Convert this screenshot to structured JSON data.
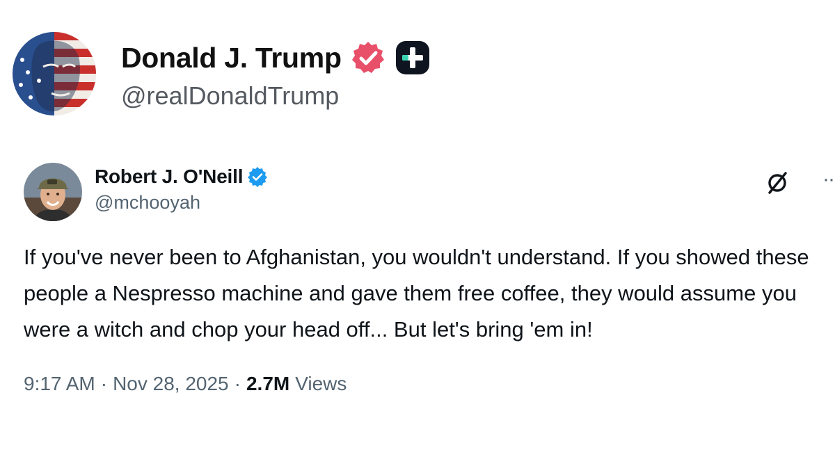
{
  "outer_post": {
    "display_name": "Donald J. Trump",
    "handle": "@realDonaldTrump",
    "avatar_icon": "flag-portrait-avatar",
    "badge_icon": "verified-badge-icon",
    "badge_color": "#e8506a",
    "plus_icon": "plus-badge-icon"
  },
  "embedded_post": {
    "display_name": "Robert J. O'Neill",
    "handle": "@mchooyah",
    "avatar_icon": "profile-photo-avatar",
    "badge_icon": "verified-badge-icon",
    "badge_color": "#1d9bf0",
    "grok_icon": "grok-icon",
    "more_icon": "more-icon",
    "more_glyph": "··",
    "text": "If you've never been to Afghanistan, you wouldn't understand. If you showed these people a Nespresso machine and gave them free coffee, they would assume you were a witch and chop your head off... But let's bring 'em in!",
    "time": "9:17 AM",
    "separator": "·",
    "date": "Nov 28, 2025",
    "views_count": "2.7M",
    "views_label": "Views"
  }
}
